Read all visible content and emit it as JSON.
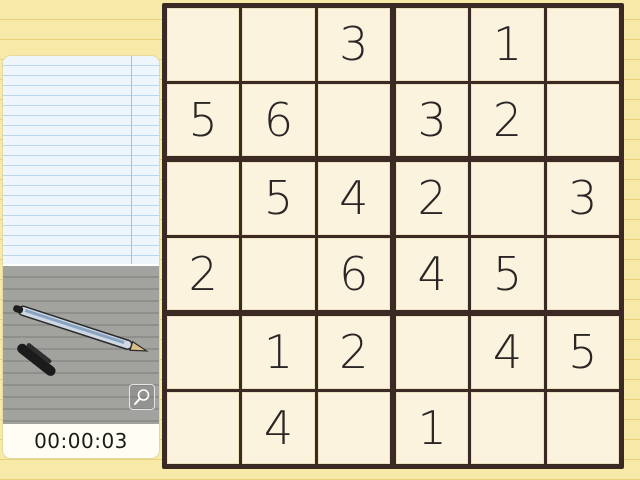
{
  "timer": "00:00:03",
  "zoom_button": {
    "icon": "magnifier-icon"
  },
  "tray": {
    "items": [
      "pen-icon",
      "pen-cap-icon"
    ]
  },
  "colors": {
    "background": "#f7e9a8",
    "board_border": "#3b2a24",
    "cell": "#fbf3de",
    "digit": "#2b2526",
    "notepad": "#eef6fc",
    "notepad_margin": "#f0a6b4",
    "tray": "#9b9b97"
  },
  "grid": {
    "rows": 6,
    "cols": 6,
    "box_rows": 2,
    "box_cols": 3,
    "cells": [
      [
        "",
        "",
        "3",
        "",
        "1",
        ""
      ],
      [
        "5",
        "6",
        "",
        "3",
        "2",
        ""
      ],
      [
        "",
        "5",
        "4",
        "2",
        "",
        "3"
      ],
      [
        "2",
        "",
        "6",
        "4",
        "5",
        ""
      ],
      [
        "",
        "1",
        "2",
        "",
        "4",
        "5"
      ],
      [
        "",
        "4",
        "",
        "1",
        "",
        ""
      ]
    ]
  }
}
